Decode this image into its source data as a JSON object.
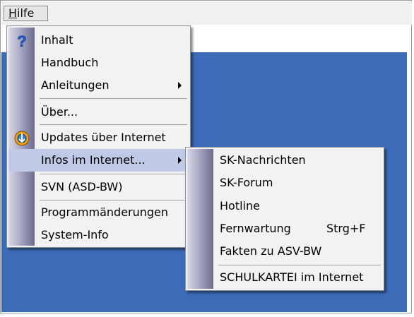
{
  "menubar": {
    "hilfe_mnemonic": "H",
    "hilfe_rest": "ilfe"
  },
  "help_menu": {
    "items": [
      {
        "label": "Inhalt",
        "icon": "help-question-icon"
      },
      {
        "label": "Handbuch"
      },
      {
        "label": "Anleitungen",
        "submenu": true
      },
      {
        "label": "Über..."
      },
      {
        "label": "Updates über Internet",
        "icon": "update-globe-icon"
      },
      {
        "label": "Infos im Internet...",
        "submenu": true,
        "highlighted": true
      },
      {
        "label": "SVN (ASD-BW)"
      },
      {
        "label": "Programmänderungen"
      },
      {
        "label": "System-Info"
      }
    ]
  },
  "submenu": {
    "items": [
      {
        "label": "SK-Nachrichten"
      },
      {
        "label": "SK-Forum"
      },
      {
        "label": "Hotline"
      },
      {
        "label": "Fernwartung",
        "shortcut": "Strg+F"
      },
      {
        "label": "Fakten zu ASV-BW"
      },
      {
        "label": "SCHULKARTEI im Internet"
      }
    ]
  },
  "colors": {
    "workspace": "#3c6cb8",
    "highlight": "#c0cae6",
    "menu_bg": "#f2f2f2"
  }
}
